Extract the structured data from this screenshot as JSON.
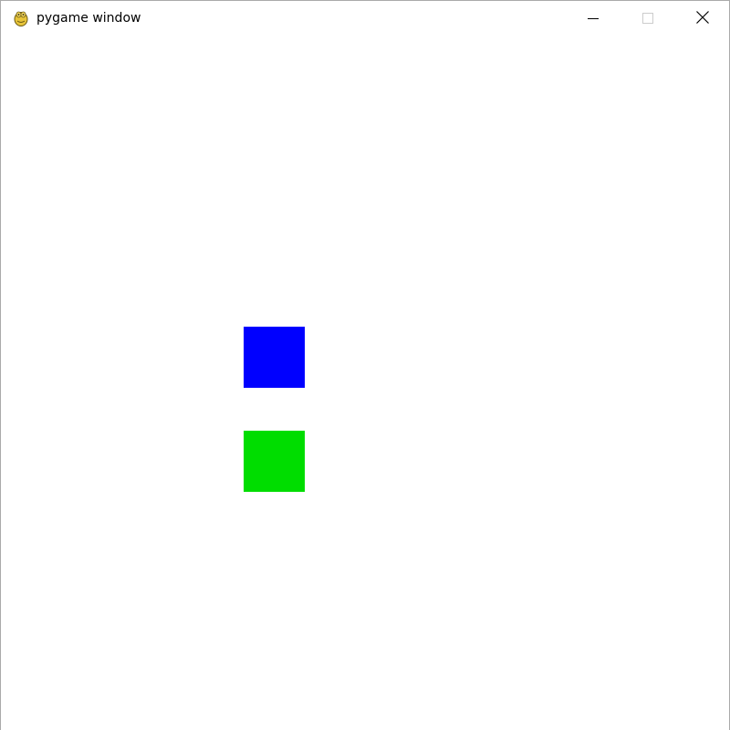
{
  "window": {
    "title": "pygame window",
    "app_icon": "pygame-snake-icon",
    "controls": {
      "minimize_icon": "minimize-icon",
      "maximize_icon": "maximize-icon",
      "close_icon": "close-icon"
    }
  },
  "canvas": {
    "background": "#ffffff",
    "squares": [
      {
        "name": "blue-square",
        "color": "#0000ff"
      },
      {
        "name": "green-square",
        "color": "#00dd00"
      }
    ]
  }
}
